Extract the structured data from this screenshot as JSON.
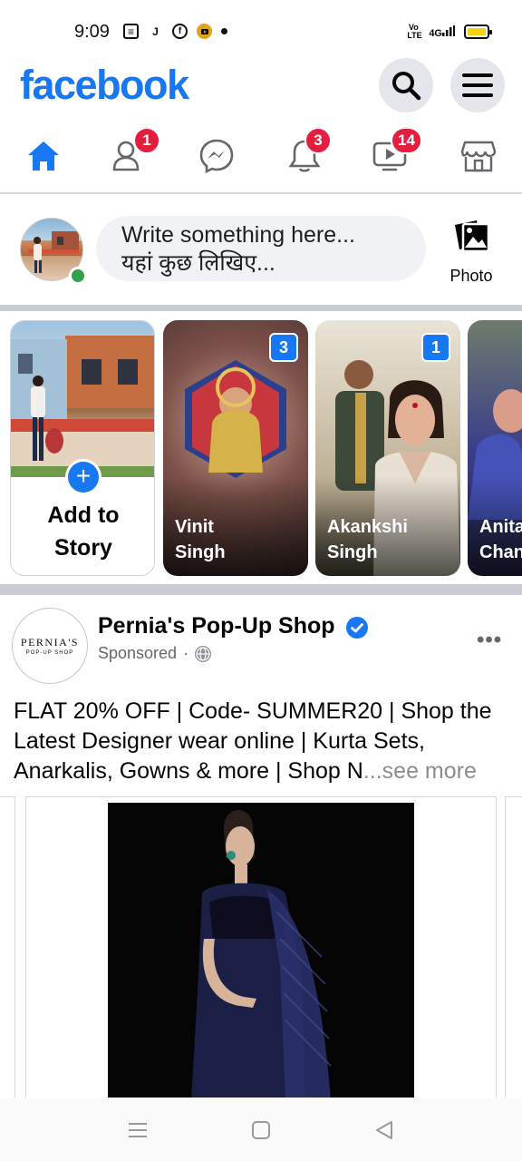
{
  "status_bar": {
    "time": "9:09",
    "icons": [
      "news-icon",
      "j-app-icon",
      "facebook-icon",
      "youtube-icon",
      "dot-icon"
    ],
    "volte": "Vo\nLTE",
    "network": "4G",
    "battery_color": "#f5d312"
  },
  "header": {
    "logo": "facebook",
    "brand_color": "#1877f2"
  },
  "nav": {
    "items": [
      {
        "name": "home",
        "active": true,
        "badge": ""
      },
      {
        "name": "friends",
        "active": false,
        "badge": "1"
      },
      {
        "name": "messenger",
        "active": false,
        "badge": ""
      },
      {
        "name": "notifications",
        "active": false,
        "badge": "3"
      },
      {
        "name": "watch",
        "active": false,
        "badge": "14"
      },
      {
        "name": "marketplace",
        "active": false,
        "badge": ""
      }
    ]
  },
  "composer": {
    "line1": "Write something here...",
    "line2": "यहां कुछ लिखिए...",
    "photo_label": "Photo"
  },
  "stories": {
    "add_line1": "Add to",
    "add_line2": "Story",
    "items": [
      {
        "first": "Vinit",
        "last": "Singh",
        "count": "3"
      },
      {
        "first": "Akankshi",
        "last": "Singh",
        "count": "1"
      },
      {
        "first": "Anita",
        "last": "Chan",
        "count": ""
      }
    ]
  },
  "post": {
    "avatar_line1": "PERNIA'S",
    "avatar_line2": "POP-UP SHOP",
    "page_name": "Pernia's Pop-Up Shop",
    "sponsored": "Sponsored",
    "separator": "·",
    "more": "•••",
    "text": "FLAT 20% OFF | Code- SUMMER20 | Shop the Latest Designer wear online | Kurta Sets, Anarkalis, Gowns & more | Shop N",
    "see_more": "...see more"
  }
}
